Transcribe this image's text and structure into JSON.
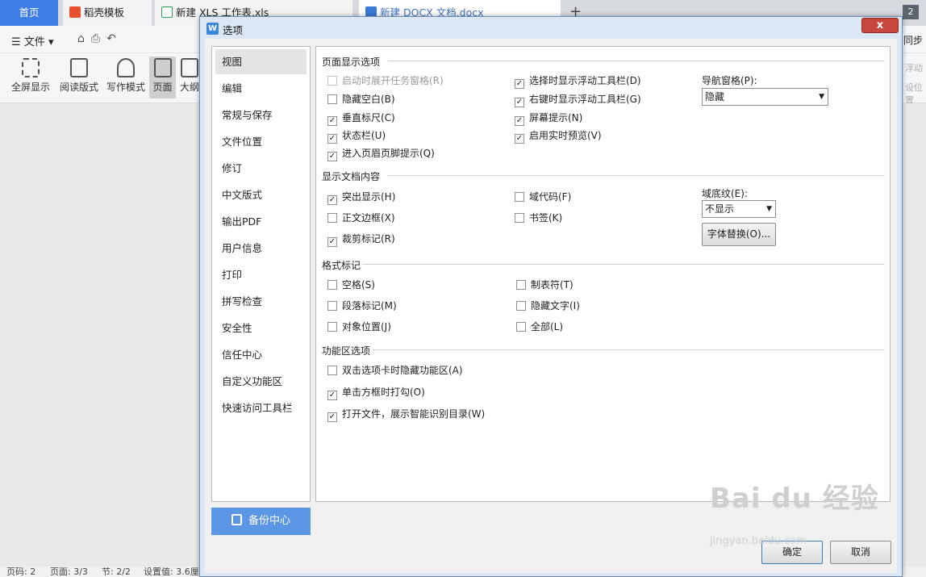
{
  "tabs": {
    "home": "首页",
    "templates": "稻壳模板",
    "xls": "新建 XLS 工作表.xls",
    "docx": "新建 DOCX 文档.docx",
    "count": "2"
  },
  "menubar": {
    "file": "文件",
    "sync": "同步"
  },
  "ribbon": {
    "fullscreen": "全屏显示",
    "reading": "阅读版式",
    "writing": "写作模式",
    "page": "页面",
    "outline": "大纲",
    "right1": "浮动",
    "right2": "设位置"
  },
  "statusbar": {
    "page": "页码: 2",
    "pages": "页面: 3/3",
    "section": "节: 2/2",
    "setting": "设置值: 3.6厘"
  },
  "dialog": {
    "title": "选项",
    "close": "x",
    "nav": [
      "视图",
      "编辑",
      "常规与保存",
      "文件位置",
      "修订",
      "中文版式",
      "输出PDF",
      "用户信息",
      "打印",
      "拼写检查",
      "安全性",
      "信任中心",
      "自定义功能区",
      "快速访问工具栏"
    ],
    "backup": "备份中心",
    "groups": {
      "page_display": "页面显示选项",
      "doc_content": "显示文档内容",
      "format_marks": "格式标记",
      "ribbon_opts": "功能区选项"
    },
    "page_display": {
      "startup_taskpane": "启动时展开任务窗格(R)",
      "hide_whitespace": "隐藏空白(B)",
      "vertical_ruler": "垂直标尺(C)",
      "status_bar": "状态栏(U)",
      "header_footer_tip": "进入页眉页脚提示(Q)",
      "float_toolbar_select": "选择时显示浮动工具栏(D)",
      "float_toolbar_right": "右键时显示浮动工具栏(G)",
      "screen_tips": "屏幕提示(N)",
      "live_preview": "启用实时预览(V)",
      "nav_pane_label": "导航窗格(P):",
      "nav_pane_value": "隐藏"
    },
    "doc_content": {
      "highlight": "突出显示(H)",
      "text_border": "正文边框(X)",
      "crop_marks": "裁剪标记(R)",
      "field_codes": "域代码(F)",
      "bookmarks": "书签(K)",
      "field_shading_label": "域底纹(E):",
      "field_shading_value": "不显示",
      "font_sub": "字体替换(O)..."
    },
    "format_marks": {
      "spaces": "空格(S)",
      "paragraph": "段落标记(M)",
      "anchors": "对象位置(J)",
      "tabs": "制表符(T)",
      "hidden_text": "隐藏文字(I)",
      "all": "全部(L)"
    },
    "ribbon_opts": {
      "dblclick_hide": "双击选项卡时隐藏功能区(A)",
      "click_check": "单击方框时打勾(O)",
      "smart_toc": "打开文件，展示智能识别目录(W)"
    },
    "ok": "确定",
    "cancel": "取消"
  },
  "watermark": {
    "brand": "Bai du 经验",
    "url": "jingyan.baidu.com"
  },
  "colors": {
    "accent": "#3c7ee6",
    "backup": "#5b97e4",
    "close": "#c9463d"
  }
}
